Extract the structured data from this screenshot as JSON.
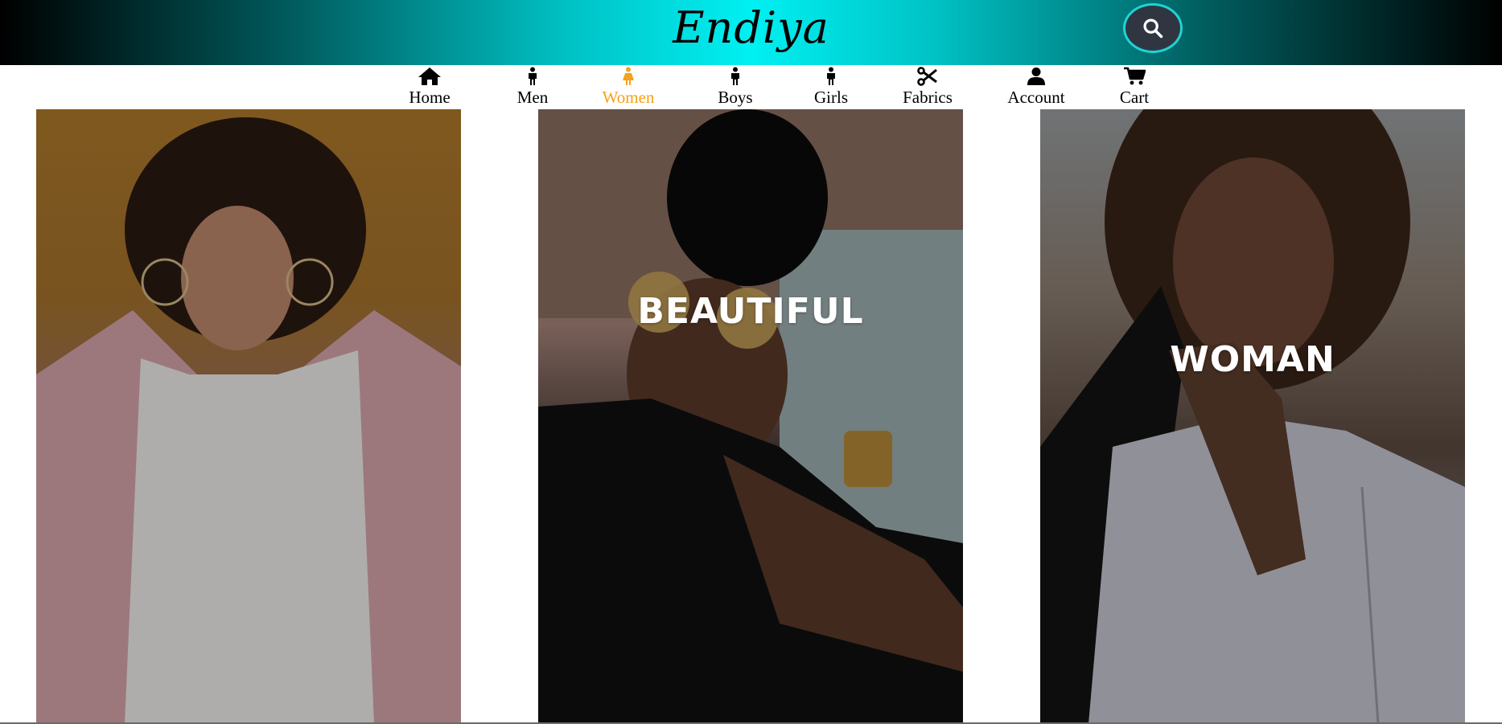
{
  "header": {
    "brand": "Endiya",
    "search_icon": "search-icon"
  },
  "nav": {
    "items": [
      {
        "label": "Home",
        "icon": "home-icon"
      },
      {
        "label": "Men",
        "icon": "person-icon"
      },
      {
        "label": "Women",
        "icon": "woman-icon",
        "active": true
      },
      {
        "label": "Boys",
        "icon": "person-icon"
      },
      {
        "label": "Girls",
        "icon": "person-icon"
      },
      {
        "label": "Fabrics",
        "icon": "scissors-icon"
      },
      {
        "label": "Account",
        "icon": "user-icon"
      },
      {
        "label": "Cart",
        "icon": "cart-icon"
      }
    ],
    "active_color": "#f5a21b"
  },
  "panels": [
    {
      "headline": ""
    },
    {
      "headline": "BEAUTIFUL"
    },
    {
      "headline": "WOMAN"
    }
  ]
}
